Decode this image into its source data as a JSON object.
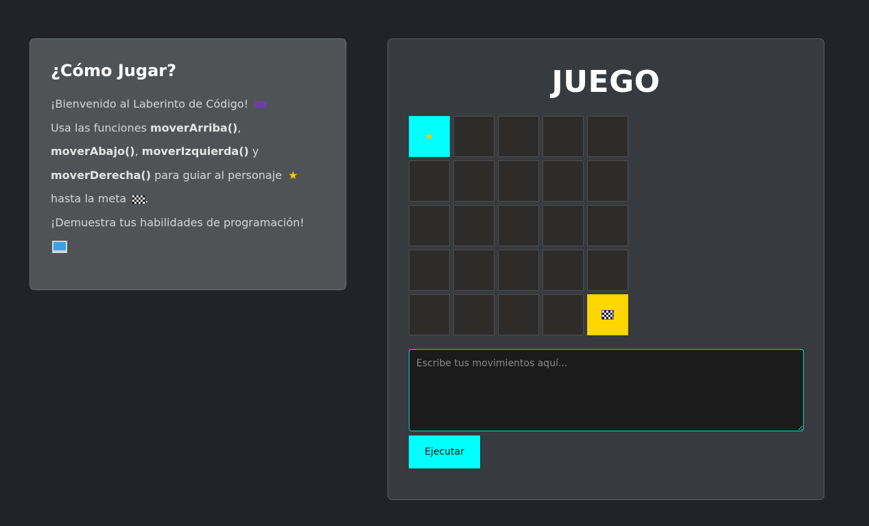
{
  "how_to_play": {
    "title": "¿Cómo Jugar?",
    "welcome": "¡Bienvenido al Laberinto de Código!",
    "use_prefix": "Usa las funciones",
    "fn_up": "moverArriba()",
    "comma1": ",",
    "fn_down": "moverAbajo()",
    "comma2": ",",
    "fn_left": "moverIzquierda()",
    "and": "y",
    "fn_right": "moverDerecha()",
    "guide_text": "para guiar al personaje",
    "goal_text": "hasta la meta",
    "period": ".",
    "closing": "¡Demuestra tus habilidades de programación!",
    "icons": {
      "welcome": "game-controller-icon",
      "player": "star-icon",
      "goal": "checkered-flag-icon",
      "closing": "laptop-icon"
    }
  },
  "game": {
    "title": "JUEGO",
    "grid": {
      "rows": 5,
      "cols": 5,
      "player": {
        "row": 0,
        "col": 0,
        "icon": "star-icon",
        "color": "#00ffff"
      },
      "goal": {
        "row": 4,
        "col": 4,
        "icon": "checkered-flag-icon",
        "color": "#ffd700"
      },
      "empty_color": "#2e2c2b"
    },
    "input": {
      "value": "",
      "placeholder": "Escribe tus movimientos aquí..."
    },
    "run_button": "Ejecutar",
    "accent_color": "#00ffff"
  }
}
